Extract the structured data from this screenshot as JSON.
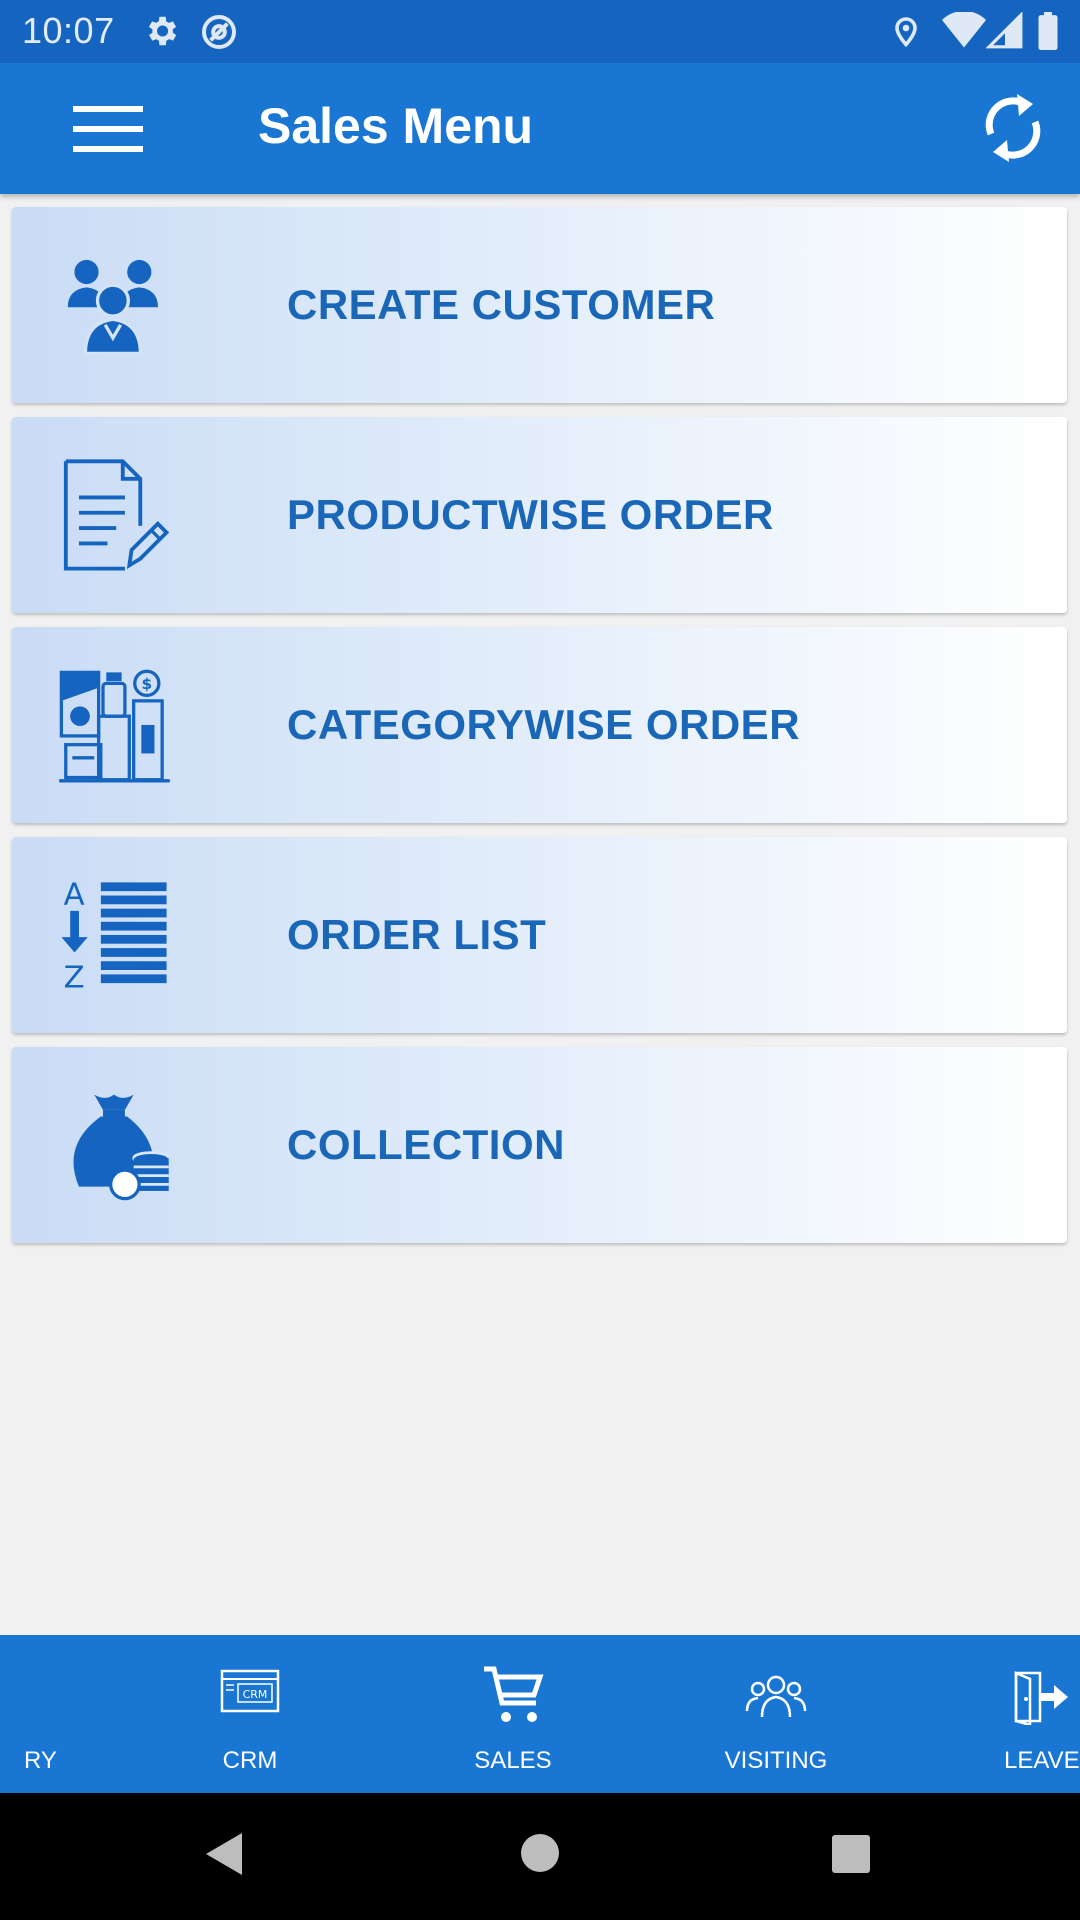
{
  "status_bar": {
    "time": "10:07",
    "icons": [
      "gear-icon",
      "at-sign-icon",
      "location-pin-icon",
      "wifi-icon",
      "signal-icon",
      "battery-icon"
    ]
  },
  "app_bar": {
    "title": "Sales Menu",
    "menu_icon": "hamburger-menu-icon",
    "refresh_icon": "refresh-icon"
  },
  "menu_items": [
    {
      "label": "CREATE CUSTOMER",
      "icon": "customers-icon"
    },
    {
      "label": "PRODUCTWISE ORDER",
      "icon": "document-edit-icon"
    },
    {
      "label": "CATEGORYWISE ORDER",
      "icon": "products-category-icon"
    },
    {
      "label": "ORDER LIST",
      "icon": "sort-az-list-icon"
    },
    {
      "label": "COLLECTION",
      "icon": "money-bag-icon"
    }
  ],
  "bottom_nav": {
    "items": [
      {
        "label": "RY",
        "icon": ""
      },
      {
        "label": "CRM",
        "icon": "crm-icon"
      },
      {
        "label": "SALES",
        "icon": "cart-icon"
      },
      {
        "label": "VISITING",
        "icon": "people-icon"
      },
      {
        "label": "LEAVE",
        "icon": "exit-door-icon"
      }
    ]
  },
  "colors": {
    "status_bar": "#1565c0",
    "app_bar": "#1976d2",
    "accent_text": "#1a67b8",
    "background": "#f1f1f1"
  }
}
